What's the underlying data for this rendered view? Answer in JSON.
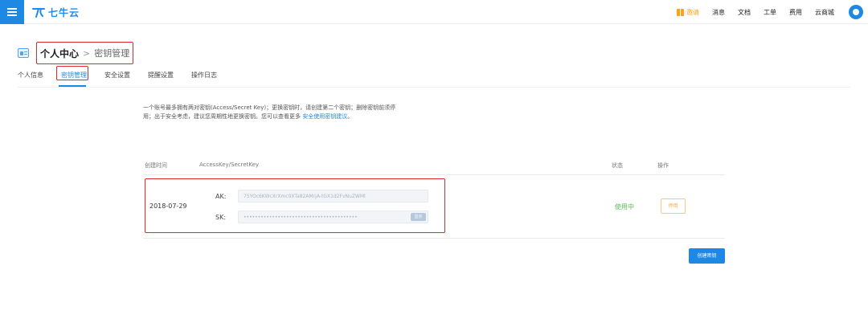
{
  "topbar": {
    "logo_text": "七牛云",
    "invite_label": "邀请",
    "nav": [
      "消息",
      "文档",
      "工单",
      "费用",
      "云商城"
    ]
  },
  "header": {
    "current": "个人中心",
    "separator": ">",
    "sub": "密钥管理"
  },
  "tabs": [
    "个人信息",
    "密钥管理",
    "安全设置",
    "提醒设置",
    "操作日志"
  ],
  "description": {
    "line1": "一个账号最多拥有两对密钥(Access/Secret Key)；更换密钥时，请创建第二个密钥；删除密钥前须停",
    "line2": "用；出于安全考虑，建议您周期性地更换密钥。您可以查看更多 ",
    "link": "安全使用密钥建议",
    "tail": "。"
  },
  "table": {
    "headers": {
      "created": "创建时间",
      "keys": "AccessKey/SecretKey",
      "status": "状态",
      "action": "操作"
    },
    "row": {
      "date": "2018-07-29",
      "ak_label": "AK:",
      "ak_value": "75YOc6KWcXrXmc0XTa82AMrjA-tGX1d2FvNuZWMl",
      "sk_label": "SK:",
      "sk_value": "••••••••••••••••••••••••••••••••••••••••",
      "show_label": "显示",
      "status": "使用中",
      "disable_label": "停用"
    }
  },
  "create_button": "创建密钥",
  "colors": {
    "accent": "#1e88e5",
    "highlight": "#e02828",
    "status_active": "#5cb85c",
    "warning": "#f0ad4e"
  }
}
